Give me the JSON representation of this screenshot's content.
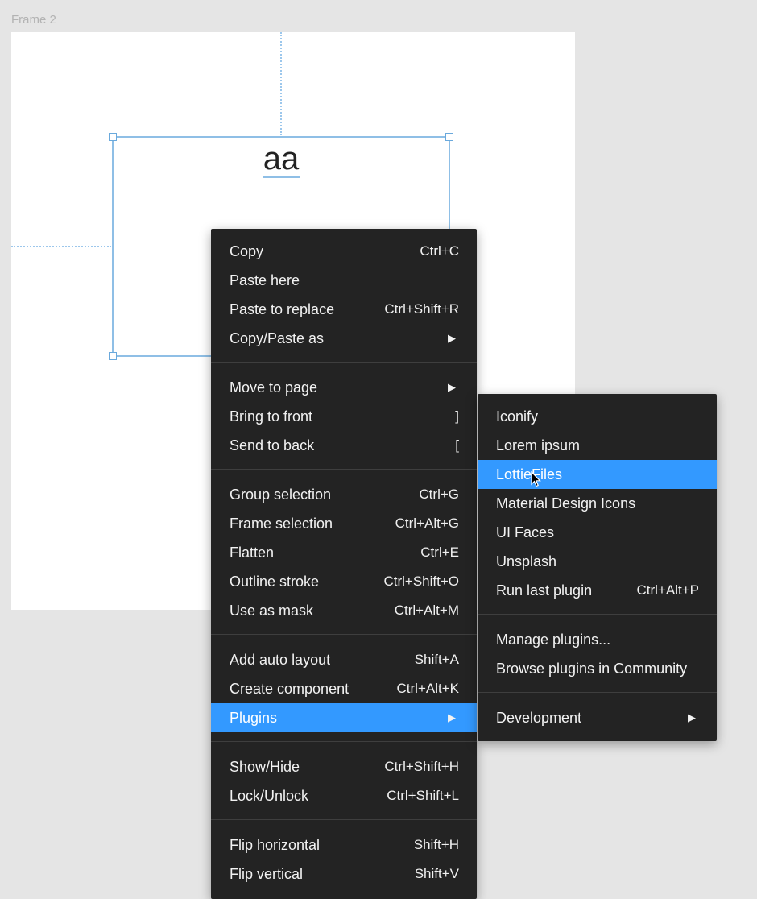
{
  "canvas": {
    "frame_label": "Frame 2",
    "text_layer": "aa"
  },
  "context_menu": {
    "groups": [
      [
        {
          "label": "Copy",
          "shortcut": "Ctrl+C"
        },
        {
          "label": "Paste here",
          "shortcut": ""
        },
        {
          "label": "Paste to replace",
          "shortcut": "Ctrl+Shift+R"
        },
        {
          "label": "Copy/Paste as",
          "shortcut": "",
          "submenu": true
        }
      ],
      [
        {
          "label": "Move to page",
          "shortcut": "",
          "submenu": true
        },
        {
          "label": "Bring to front",
          "shortcut": "]"
        },
        {
          "label": "Send to back",
          "shortcut": "["
        }
      ],
      [
        {
          "label": "Group selection",
          "shortcut": "Ctrl+G"
        },
        {
          "label": "Frame selection",
          "shortcut": "Ctrl+Alt+G"
        },
        {
          "label": "Flatten",
          "shortcut": "Ctrl+E"
        },
        {
          "label": "Outline stroke",
          "shortcut": "Ctrl+Shift+O"
        },
        {
          "label": "Use as mask",
          "shortcut": "Ctrl+Alt+M"
        }
      ],
      [
        {
          "label": "Add auto layout",
          "shortcut": "Shift+A"
        },
        {
          "label": "Create component",
          "shortcut": "Ctrl+Alt+K"
        },
        {
          "label": "Plugins",
          "shortcut": "",
          "submenu": true,
          "active": true
        }
      ],
      [
        {
          "label": "Show/Hide",
          "shortcut": "Ctrl+Shift+H"
        },
        {
          "label": "Lock/Unlock",
          "shortcut": "Ctrl+Shift+L"
        }
      ],
      [
        {
          "label": "Flip horizontal",
          "shortcut": "Shift+H"
        },
        {
          "label": "Flip vertical",
          "shortcut": "Shift+V"
        }
      ]
    ]
  },
  "plugins_menu": {
    "groups": [
      [
        {
          "label": "Iconify",
          "shortcut": ""
        },
        {
          "label": "Lorem ipsum",
          "shortcut": ""
        },
        {
          "label": "LottieFiles",
          "shortcut": "",
          "active": true
        },
        {
          "label": "Material Design Icons",
          "shortcut": ""
        },
        {
          "label": "UI Faces",
          "shortcut": ""
        },
        {
          "label": "Unsplash",
          "shortcut": ""
        },
        {
          "label": "Run last plugin",
          "shortcut": "Ctrl+Alt+P"
        }
      ],
      [
        {
          "label": "Manage plugins...",
          "shortcut": ""
        },
        {
          "label": "Browse plugins in Community",
          "shortcut": ""
        }
      ],
      [
        {
          "label": "Development",
          "shortcut": "",
          "submenu": true
        }
      ]
    ]
  },
  "colors": {
    "menu_bg": "#232323",
    "highlight": "#3399ff",
    "selection": "#8fbfe6"
  }
}
